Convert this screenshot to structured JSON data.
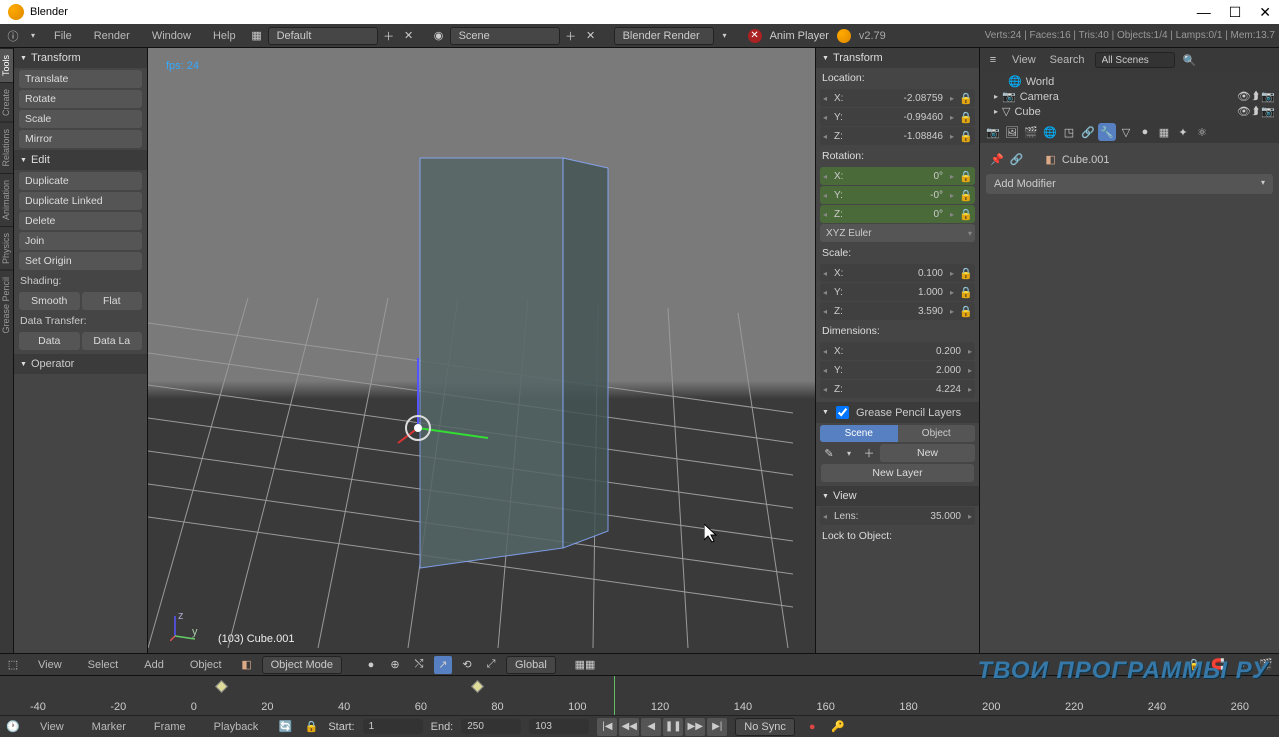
{
  "title": "Blender",
  "menus": [
    "File",
    "Render",
    "Window",
    "Help"
  ],
  "layouts": {
    "active": "Default"
  },
  "scene": "Scene",
  "renderer": "Blender Render",
  "anim_player": "Anim Player",
  "version": "v2.79",
  "stats": "Verts:24 | Faces:16 | Tris:40 | Objects:1/4 | Lamps:0/1 | Mem:13.7",
  "vtabs": [
    "Tools",
    "Create",
    "Relations",
    "Animation",
    "Physics",
    "Grease Pencil"
  ],
  "toolshelf": {
    "transform_hdr": "Transform",
    "translate": "Translate",
    "rotate": "Rotate",
    "scale": "Scale",
    "mirror": "Mirror",
    "edit_hdr": "Edit",
    "duplicate": "Duplicate",
    "dup_linked": "Duplicate Linked",
    "delete": "Delete",
    "join": "Join",
    "set_origin": "Set Origin",
    "shading": "Shading:",
    "smooth": "Smooth",
    "flat": "Flat",
    "data_transfer": "Data Transfer:",
    "data": "Data",
    "data_la": "Data La",
    "operator_hdr": "Operator"
  },
  "viewport": {
    "fps": "fps: 24",
    "obj_label": "(103) Cube.001"
  },
  "nprops": {
    "transform_hdr": "Transform",
    "loc": "Location:",
    "loc_x": "-2.08759",
    "loc_y": "-0.99460",
    "loc_z": "-1.08846",
    "rot": "Rotation:",
    "rot_x": "0°",
    "rot_y": "-0°",
    "rot_z": "0°",
    "rot_mode": "XYZ Euler",
    "scale": "Scale:",
    "sc_x": "0.100",
    "sc_y": "1.000",
    "sc_z": "3.590",
    "dims": "Dimensions:",
    "d_x": "0.200",
    "d_y": "2.000",
    "d_z": "4.224",
    "gp": "Grease Pencil Layers",
    "scene_btn": "Scene",
    "object_btn": "Object",
    "new": "New",
    "new_layer": "New Layer",
    "view": "View",
    "lens": "Lens:",
    "lens_v": "35.000",
    "lock": "Lock to Object:"
  },
  "outliner": {
    "view": "View",
    "search": "Search",
    "filter": "All Scenes",
    "world": "World",
    "camera": "Camera",
    "cube": "Cube"
  },
  "mod_panel": {
    "obj": "Cube.001",
    "add": "Add Modifier"
  },
  "viewhdr": {
    "view": "View",
    "select": "Select",
    "add": "Add",
    "object": "Object",
    "mode": "Object Mode",
    "orient": "Global"
  },
  "timeline": {
    "labels": [
      "-40",
      "-20",
      "0",
      "20",
      "40",
      "60",
      "80",
      "100",
      "120",
      "140",
      "160",
      "180",
      "200",
      "220",
      "240",
      "260"
    ],
    "view": "View",
    "marker": "Marker",
    "frame": "Frame",
    "playback": "Playback",
    "start_lbl": "Start:",
    "start": "1",
    "end_lbl": "End:",
    "end": "250",
    "current": "103",
    "nosync": "No Sync"
  },
  "watermark": "ТВОИ ПРОГРАММЫ РУ"
}
